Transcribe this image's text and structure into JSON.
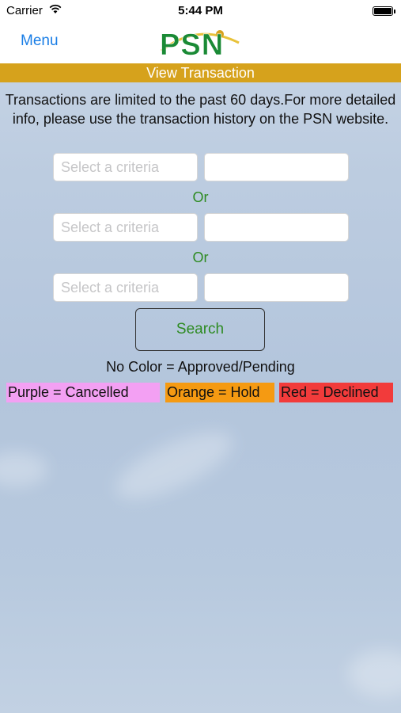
{
  "status_bar": {
    "carrier": "Carrier",
    "time": "5:44 PM"
  },
  "nav": {
    "menu_label": "Menu",
    "logo_text": "PSN",
    "logo_color": "#1a8a35"
  },
  "title_bar": {
    "label": "View Transaction",
    "color": "#d6a21c"
  },
  "info_text": "Transactions are limited to the past 60 days.For more detailed info, please use the transaction history on the PSN website.",
  "criteria_rows": [
    {
      "select_placeholder": "Select a criteria",
      "input_value": ""
    },
    {
      "select_placeholder": "Select a criteria",
      "input_value": ""
    },
    {
      "select_placeholder": "Select a criteria",
      "input_value": ""
    }
  ],
  "or_label": "Or",
  "search_label": "Search",
  "legend": {
    "approved": "No Color = Approved/Pending",
    "cancelled": {
      "label": "Purple = Cancelled",
      "color": "#f3a0f3"
    },
    "hold": {
      "label": "Orange = Hold",
      "color": "#f59a12"
    },
    "declined": {
      "label": "Red = Declined",
      "color": "#f23b3b"
    }
  }
}
